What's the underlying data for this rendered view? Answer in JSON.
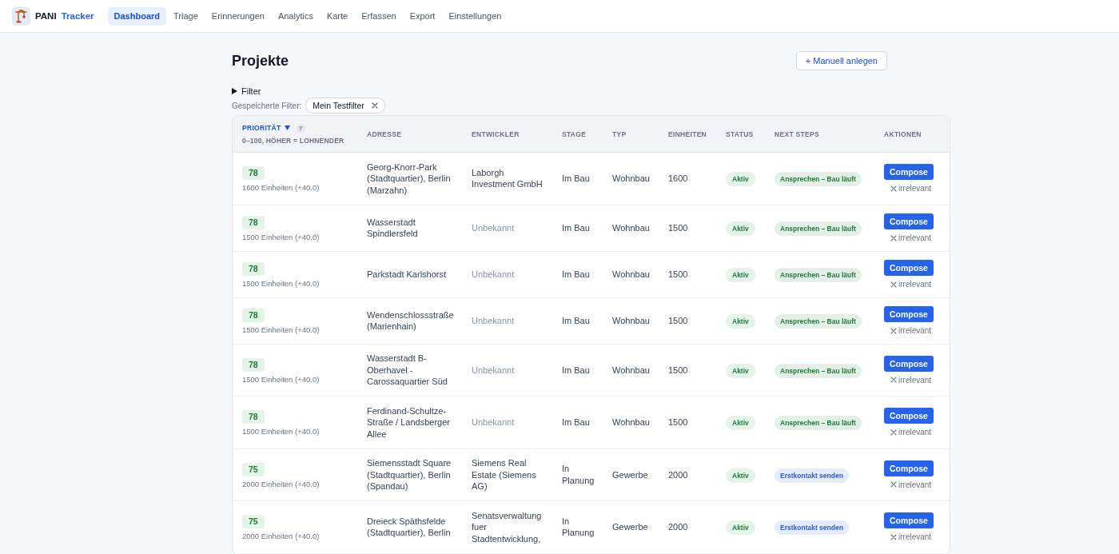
{
  "nav": {
    "brand": {
      "name": "PANI",
      "product": "Tracker"
    },
    "tabs": [
      {
        "label": "Dashboard",
        "selected": true
      },
      {
        "label": "Triage",
        "selected": false
      },
      {
        "label": "Erinnerungen",
        "selected": false
      },
      {
        "label": "Analytics",
        "selected": false
      },
      {
        "label": "Karte",
        "selected": false
      },
      {
        "label": "Erfassen",
        "selected": false
      },
      {
        "label": "Export",
        "selected": false
      },
      {
        "label": "Einstellungen",
        "selected": false
      }
    ]
  },
  "header": {
    "title": "Projekte",
    "action": "+ Manuell anlegen"
  },
  "filter": {
    "label": "Filter",
    "expanded": false
  },
  "saved_filters": {
    "label": "Gespeicherte Filter:",
    "items": [
      {
        "label": "Mein Testfilter"
      }
    ]
  },
  "table": {
    "columns": [
      {
        "label": "PRIORITÄT",
        "sorted": true,
        "help": "?",
        "note": "0–100, HÖHER = LOHNENDER"
      },
      {
        "label": "ADRESSE",
        "sorted": false
      },
      {
        "label": "ENTWICKLER",
        "sorted": false
      },
      {
        "label": "STAGE",
        "sorted": false
      },
      {
        "label": "TYP",
        "sorted": false
      },
      {
        "label": "EINHEITEN",
        "sorted": false
      },
      {
        "label": "STATUS",
        "sorted": false
      },
      {
        "label": "NEXT STEPS",
        "sorted": false
      },
      {
        "label": "AKTIONEN",
        "sorted": false
      }
    ],
    "rows": [
      {
        "score": "78",
        "score_note": "1600 Einheiten (+40.0)",
        "address": "Georg-Knorr-Park (Stadtquartier), Berlin (Marzahn)",
        "developer": "Laborgh Investment GmbH",
        "developer_known": true,
        "stage": "Im Bau",
        "type": "Wohnbau",
        "units": "1600",
        "status": "Aktiv",
        "next_step": {
          "label": "Ansprechen – Bau läuft",
          "color": "#1e7b3a"
        },
        "action": "Compose",
        "dismiss": "irrelevant"
      },
      {
        "score": "78",
        "score_note": "1500 Einheiten (+40.0)",
        "address": "Wasserstadt Spindlersfeld",
        "developer": "Unbekannt",
        "developer_known": false,
        "stage": "Im Bau",
        "type": "Wohnbau",
        "units": "1500",
        "status": "Aktiv",
        "next_step": {
          "label": "Ansprechen – Bau läuft",
          "color": "#1e7b3a"
        },
        "action": "Compose",
        "dismiss": "irrelevant"
      },
      {
        "score": "78",
        "score_note": "1500 Einheiten (+40.0)",
        "address": "Parkstadt Karlshorst",
        "developer": "Unbekannt",
        "developer_known": false,
        "stage": "Im Bau",
        "type": "Wohnbau",
        "units": "1500",
        "status": "Aktiv",
        "next_step": {
          "label": "Ansprechen – Bau läuft",
          "color": "#1e7b3a"
        },
        "action": "Compose",
        "dismiss": "irrelevant"
      },
      {
        "score": "78",
        "score_note": "1500 Einheiten (+40.0)",
        "address": "Wendenschlossstraße (Marienhain)",
        "developer": "Unbekannt",
        "developer_known": false,
        "stage": "Im Bau",
        "type": "Wohnbau",
        "units": "1500",
        "status": "Aktiv",
        "next_step": {
          "label": "Ansprechen – Bau läuft",
          "color": "#1e7b3a"
        },
        "action": "Compose",
        "dismiss": "irrelevant"
      },
      {
        "score": "78",
        "score_note": "1500 Einheiten (+40.0)",
        "address": "Wasserstadt B-Oberhavel - Carossaquartier Süd",
        "developer": "Unbekannt",
        "developer_known": false,
        "stage": "Im Bau",
        "type": "Wohnbau",
        "units": "1500",
        "status": "Aktiv",
        "next_step": {
          "label": "Ansprechen – Bau läuft",
          "color": "#1e7b3a"
        },
        "action": "Compose",
        "dismiss": "irrelevant"
      },
      {
        "score": "78",
        "score_note": "1500 Einheiten (+40.0)",
        "address": "Ferdinand-Schultze-Straße / Landsberger Allee",
        "developer": "Unbekannt",
        "developer_known": false,
        "stage": "Im Bau",
        "type": "Wohnbau",
        "units": "1500",
        "status": "Aktiv",
        "next_step": {
          "label": "Ansprechen – Bau läuft",
          "color": "#1e7b3a"
        },
        "action": "Compose",
        "dismiss": "irrelevant"
      },
      {
        "score": "75",
        "score_note": "2000 Einheiten (+40.0)",
        "address": "Siemensstadt Square (Stadtquartier), Berlin (Spandau)",
        "developer": "Siemens Real Estate (Siemens AG)",
        "developer_known": true,
        "stage": "In Planung",
        "type": "Gewerbe",
        "units": "2000",
        "status": "Aktiv",
        "next_step": {
          "label": "Erstkontakt senden",
          "color": "#2f5bd3"
        },
        "action": "Compose",
        "dismiss": "irrelevant"
      },
      {
        "score": "75",
        "score_note": "2000 Einheiten (+40.0)",
        "address": "Dreieck Späthsfelde (Stadtquartier), Berlin",
        "developer": "Senatsverwaltung fuer Stadtentwicklung,",
        "developer_known": true,
        "stage": "In Planung",
        "type": "Gewerbe",
        "units": "2000",
        "status": "Aktiv",
        "next_step": {
          "label": "Erstkontakt senden",
          "color": "#2f5bd3"
        },
        "action": "Compose",
        "dismiss": "irrelevant"
      }
    ]
  }
}
